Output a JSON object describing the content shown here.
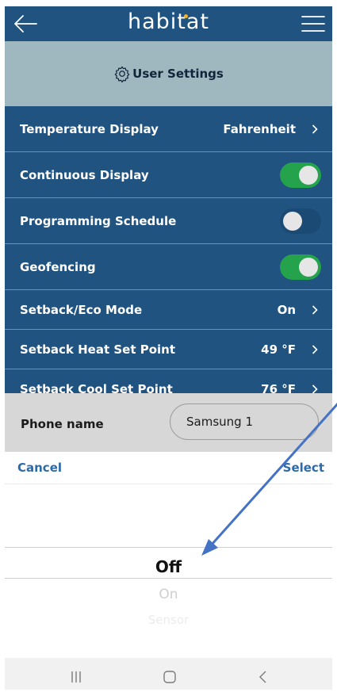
{
  "app": {
    "brand": "habitat"
  },
  "header": {
    "title": "User Settings"
  },
  "rows": [
    {
      "label": "Temperature Display",
      "value": "Fahrenheit"
    },
    {
      "label": "Continuous Display",
      "toggle": "on"
    },
    {
      "label": "Programming Schedule",
      "toggle": "off"
    },
    {
      "label": "Geofencing",
      "toggle": "on"
    },
    {
      "label": "Setback/Eco Mode",
      "value": "On"
    },
    {
      "label": "Setback Heat Set Point",
      "value": "49 °F"
    },
    {
      "label": "Setback Cool Set Point",
      "value": "76 °F"
    }
  ],
  "phone": {
    "label": "Phone name",
    "value": "Samsung 1"
  },
  "sheet": {
    "cancel_label": "Cancel",
    "select_label": "Select",
    "options": [
      "Off",
      "On",
      "Sensor"
    ],
    "selected": "Off"
  },
  "colors": {
    "nav_blue": "#205380",
    "header_gray_blue": "#9fb7bf",
    "toggle_on_green": "#24a24c",
    "link_blue": "#2d6aa8",
    "annotation_arrow": "#4472c4"
  },
  "icons": [
    "back-arrow-icon",
    "hamburger-menu-icon",
    "gear-icon",
    "chevron-right-icon",
    "recents-icon",
    "home-icon",
    "back-icon"
  ]
}
